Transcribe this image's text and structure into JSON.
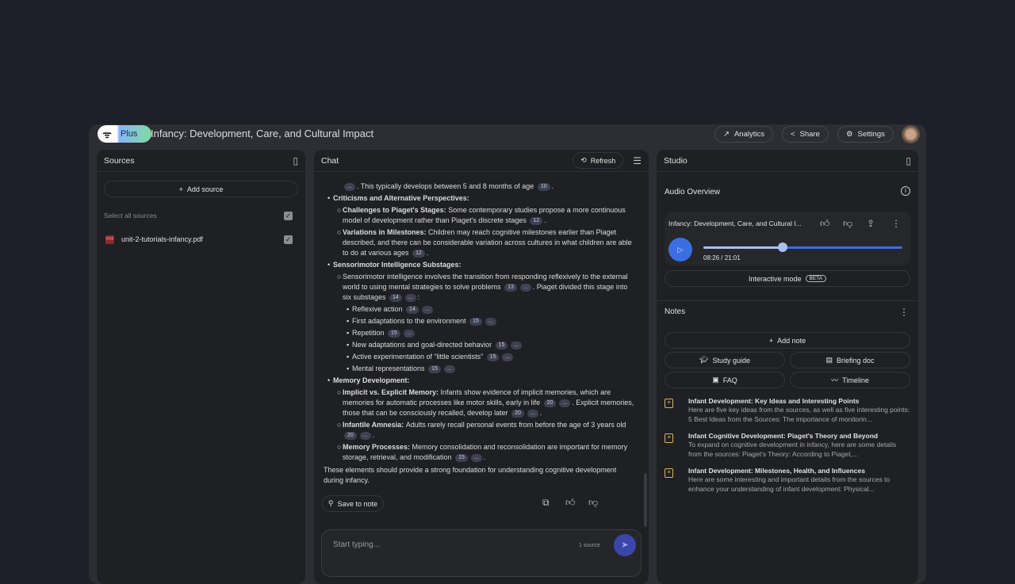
{
  "header": {
    "badge": "Plus",
    "title": "Infancy: Development, Care, and Cultural Impact",
    "analytics": "Analytics",
    "share": "Share",
    "settings": "Settings"
  },
  "sources": {
    "title": "Sources",
    "add": "Add source",
    "select_all": "Select all sources",
    "items": [
      {
        "name": "unit-2-tutorials-infancy.pdf",
        "type": "PDF",
        "checked": true
      }
    ]
  },
  "chat": {
    "title": "Chat",
    "refresh": "Refresh",
    "save_to_note": "Save to note",
    "input_placeholder": "Start typing...",
    "source_count": "1 source",
    "blocks": [
      {
        "level": 2,
        "bullet": "",
        "segs": [
          {
            "e": 1
          },
          {
            "t": ". This typically develops between 5 and 8 months of age "
          },
          {
            "c": "10"
          },
          {
            "t": "."
          }
        ]
      },
      {
        "level": 1,
        "bullet": "•",
        "segs": [
          {
            "b": "Criticisms and Alternative Perspectives:"
          }
        ]
      },
      {
        "level": 2,
        "bullet": "○",
        "segs": [
          {
            "b": "Challenges to Piaget's Stages: "
          },
          {
            "t": "Some contemporary studies propose a more continuous model of development rather than Piaget's discrete stages "
          },
          {
            "c": "12"
          },
          {
            "t": "."
          }
        ]
      },
      {
        "level": 2,
        "bullet": "○",
        "segs": [
          {
            "b": "Variations in Milestones: "
          },
          {
            "t": "Children may reach cognitive milestones earlier than Piaget described, and there can be considerable variation across cultures in what children are able to do at various ages "
          },
          {
            "c": "12"
          },
          {
            "t": "."
          }
        ]
      },
      {
        "level": 1,
        "bullet": "•",
        "segs": [
          {
            "b": "Sensorimotor Intelligence Substages:"
          }
        ]
      },
      {
        "level": 2,
        "bullet": "○",
        "segs": [
          {
            "t": "Sensorimotor intelligence involves the transition from responding reflexively to the external world to using mental strategies to solve problems "
          },
          {
            "c": "13"
          },
          {
            "e": 1
          },
          {
            "t": ". Piaget divided this stage into six substages "
          },
          {
            "c": "14"
          },
          {
            "e": 1
          },
          {
            "t": ":"
          }
        ]
      },
      {
        "level": 3,
        "bullet": "▪",
        "segs": [
          {
            "t": "Reflexive action "
          },
          {
            "c": "14"
          },
          {
            "e": 1
          }
        ]
      },
      {
        "level": 3,
        "bullet": "▪",
        "segs": [
          {
            "t": "First adaptations to the environment "
          },
          {
            "c": "15"
          },
          {
            "e": 1
          }
        ]
      },
      {
        "level": 3,
        "bullet": "▪",
        "segs": [
          {
            "t": "Repetition "
          },
          {
            "c": "15"
          },
          {
            "e": 1
          }
        ]
      },
      {
        "level": 3,
        "bullet": "▪",
        "segs": [
          {
            "t": "New adaptations and goal-directed behavior "
          },
          {
            "c": "15"
          },
          {
            "e": 1
          }
        ]
      },
      {
        "level": 3,
        "bullet": "▪",
        "segs": [
          {
            "t": "Active experimentation of “little scientists” "
          },
          {
            "c": "15"
          },
          {
            "e": 1
          }
        ]
      },
      {
        "level": 3,
        "bullet": "▪",
        "segs": [
          {
            "t": "Mental representations "
          },
          {
            "c": "15"
          },
          {
            "e": 1
          }
        ]
      },
      {
        "level": 1,
        "bullet": "•",
        "segs": [
          {
            "b": "Memory Development:"
          }
        ]
      },
      {
        "level": 2,
        "bullet": "○",
        "segs": [
          {
            "b": "Implicit vs. Explicit Memory: "
          },
          {
            "t": "Infants show evidence of implicit memories, which are memories for automatic processes like motor skills, early in life "
          },
          {
            "c": "20"
          },
          {
            "e": 1
          },
          {
            "t": ". Explicit memories, those that can be consciously recalled, develop later "
          },
          {
            "c": "20"
          },
          {
            "e": 1
          },
          {
            "t": "."
          }
        ]
      },
      {
        "level": 2,
        "bullet": "○",
        "segs": [
          {
            "b": "Infantile Amnesia: "
          },
          {
            "t": "Adults rarely recall personal events from before the age of 3 years old "
          },
          {
            "c": "20"
          },
          {
            "e": 1
          },
          {
            "t": "."
          }
        ]
      },
      {
        "level": 2,
        "bullet": "○",
        "segs": [
          {
            "b": "Memory Processes: "
          },
          {
            "t": "Memory consolidation and reconsolidation are important for memory storage, retrieval, and modification "
          },
          {
            "c": "15"
          },
          {
            "e": 1
          },
          {
            "t": "."
          }
        ]
      },
      {
        "level": 0,
        "bullet": "",
        "segs": [
          {
            "t": "These elements should provide a strong foundation for understanding cognitive development during infancy."
          }
        ]
      }
    ]
  },
  "studio": {
    "title": "Studio",
    "audio_title": "Audio Overview",
    "audio_name": "Infancy: Development, Care, and Cultural I...",
    "time": "08:26 / 21:01",
    "progress": 0.4,
    "interactive": "Interactive mode",
    "beta": "BETA",
    "notes_title": "Notes",
    "add_note": "Add note",
    "study_guide": "Study guide",
    "briefing": "Briefing doc",
    "faq": "FAQ",
    "timeline": "Timeline",
    "notes": [
      {
        "title": "Infant Development: Key Ideas and Interesting Points",
        "desc": "Here are five key ideas from the sources, as well as five interesting points: 5 Best Ideas from the Sources: The importance of monitorin..."
      },
      {
        "title": "Infant Cognitive Development: Piaget's Theory and Beyond",
        "desc": "To expand on cognitive development in infancy, here are some details from the sources: Piaget's Theory: According to Piaget,..."
      },
      {
        "title": "Infant Development: Milestones, Health, and Influences",
        "desc": "Here are some interesting and important details from the sources to enhance your understanding of infant development: Physical..."
      }
    ]
  },
  "colors": {
    "accent": "#3b6ee0",
    "progress": "#a8c0f0",
    "note_icon": "#d7b46a"
  }
}
